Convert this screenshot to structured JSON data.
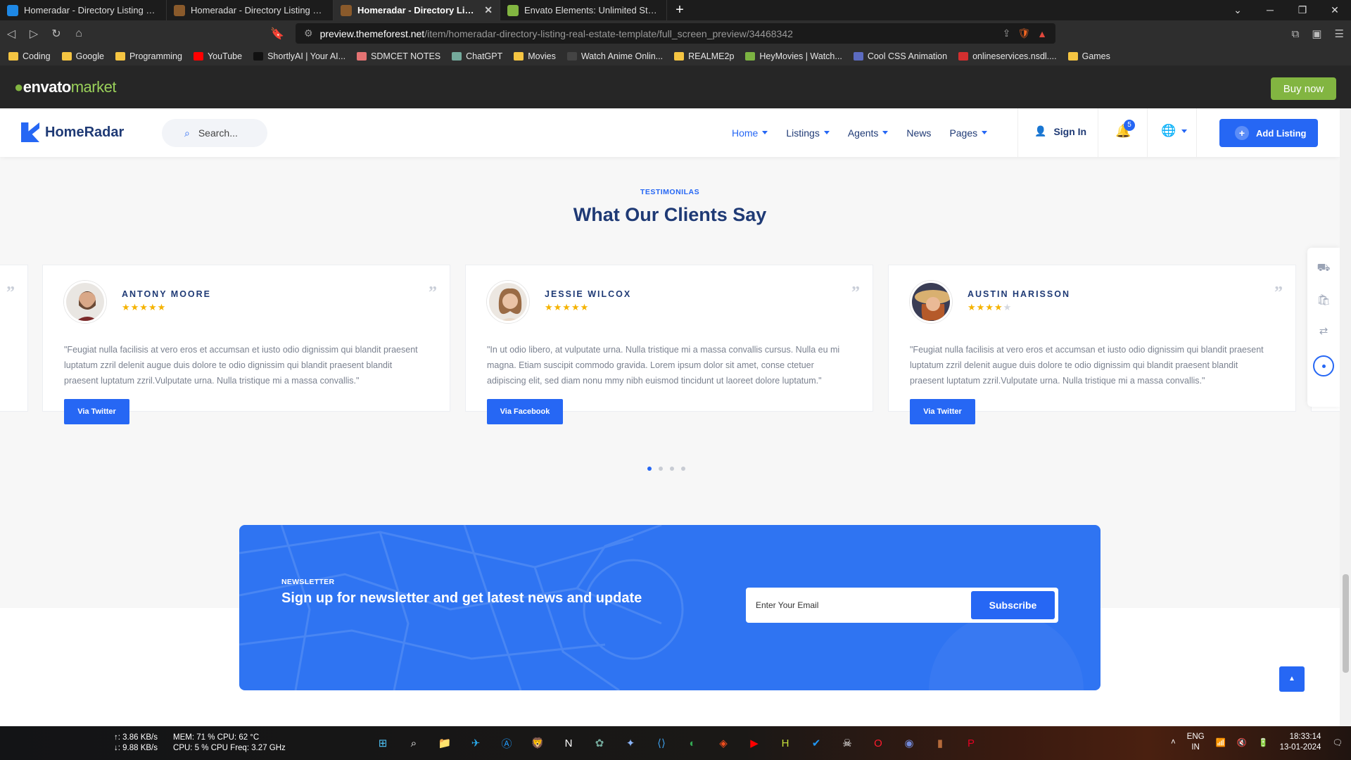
{
  "browser": {
    "tabs": [
      {
        "title": "Homeradar - Directory Listing Real Est",
        "color": "#1e88e5",
        "active": false
      },
      {
        "title": "Homeradar - Directory Listing Real Est",
        "color": "#8a5a2b",
        "active": false
      },
      {
        "title": "Homeradar - Directory Listing Re",
        "color": "#8a5a2b",
        "active": true
      },
      {
        "title": "Envato Elements: Unlimited Stock Vide",
        "color": "#82b541",
        "active": false
      }
    ],
    "url_domain": "preview.themeforest.net",
    "url_path": "/item/homeradar-directory-listing-real-estate-template/full_screen_preview/34468342",
    "bookmarks": [
      {
        "label": "Coding",
        "color": "#f5c542"
      },
      {
        "label": "Google",
        "color": "#f5c542"
      },
      {
        "label": "Programming",
        "color": "#f5c542"
      },
      {
        "label": "YouTube",
        "color": "#ff0000"
      },
      {
        "label": "ShortlyAI | Your AI...",
        "color": "#111111"
      },
      {
        "label": "SDMCET NOTES",
        "color": "#e57373"
      },
      {
        "label": "ChatGPT",
        "color": "#74aa9c"
      },
      {
        "label": "Movies",
        "color": "#f5c542"
      },
      {
        "label": "Watch Anime Onlin...",
        "color": "#444444"
      },
      {
        "label": "REALME2p",
        "color": "#f5c542"
      },
      {
        "label": "HeyMovies | Watch...",
        "color": "#7cb342"
      },
      {
        "label": "Cool CSS Animation",
        "color": "#5c6bc0"
      },
      {
        "label": "onlineservices.nsdl....",
        "color": "#d32f2f"
      },
      {
        "label": "Games",
        "color": "#f5c542"
      }
    ]
  },
  "envato": {
    "logo": "envato",
    "logo_suffix": "market",
    "buy_now": "Buy now"
  },
  "header": {
    "logo": "HomeRadar",
    "search_placeholder": "Search...",
    "nav": [
      "Home",
      "Listings",
      "Agents",
      "News",
      "Pages"
    ],
    "sign_in": "Sign In",
    "notifications": "5",
    "add_listing": "Add Listing"
  },
  "testimonials": {
    "tag": "TESTIMONILAS",
    "title": "What Our Clients Say",
    "cards": [
      {
        "name": "ANTONY MOORE",
        "rating": 5,
        "text": "\"Feugiat nulla facilisis at vero eros et accumsan et iusto odio dignissim qui blandit praesent luptatum zzril delenit augue duis dolore te odio dignissim qui blandit praesent blandit praesent luptatum zzril.Vulputate urna. Nulla tristique mi a massa convallis.\"",
        "button": "Via Twitter"
      },
      {
        "name": "JESSIE WILCOX",
        "rating": 5,
        "text": "\"In ut odio libero, at vulputate urna. Nulla tristique mi a massa convallis cursus. Nulla eu mi magna. Etiam suscipit commodo gravida. Lorem ipsum dolor sit amet, conse ctetuer adipiscing elit, sed diam nonu mmy nibh euismod tincidunt ut laoreet dolore luptatum.\"",
        "button": "Via Facebook"
      },
      {
        "name": "AUSTIN HARISSON",
        "rating": 4,
        "text": "\"Feugiat nulla facilisis at vero eros et accumsan et iusto odio dignissim qui blandit praesent luptatum zzril delenit augue duis dolore te odio dignissim qui blandit praesent blandit praesent luptatum zzril.Vulputate urna. Nulla tristique mi a massa convallis.\"",
        "button": "Via Twitter"
      }
    ],
    "pager_count": 4,
    "pager_active": 1
  },
  "newsletter": {
    "tag": "NEWSLETTER",
    "title": "Sign up for newsletter and get latest news and update",
    "placeholder": "Enter Your Email",
    "button": "Subscribe"
  },
  "taskbar": {
    "net_up": "↑: 3.86 KB/s",
    "net_down": "↓: 9.88 KB/s",
    "mem": "MEM: 71 %  CPU: 62 °C",
    "cpu": "CPU: 5 %     CPU Freq: 3.27 GHz",
    "lang1": "ENG",
    "lang2": "IN",
    "time": "18:33:14",
    "date": "13-01-2024"
  }
}
